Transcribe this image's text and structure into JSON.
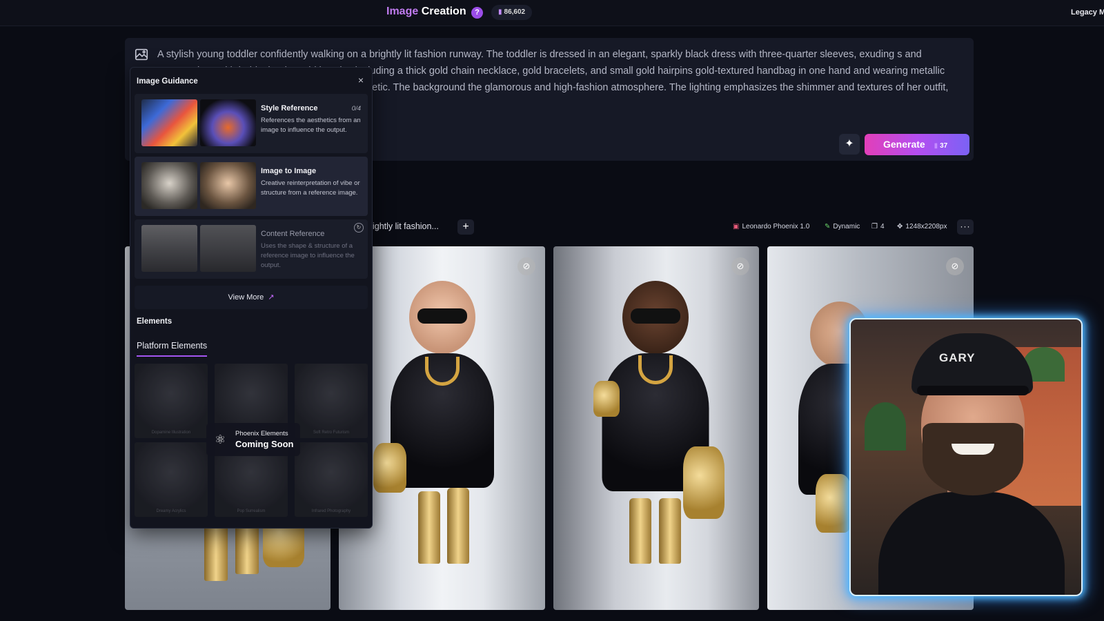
{
  "header": {
    "title_part1": "Image",
    "title_part2": "Creation",
    "help_glyph": "?",
    "tokens": "86,602",
    "legacy_label": "Legacy M"
  },
  "prompt": {
    "text": "A stylish young toddler confidently walking on a brightly lit fashion runway. The toddler is dressed in an elegant, sparkly black dress with three-quarter sleeves, exuding s and accessorizes with bold, chunky gold jewelry, including a thick gold chain necklace, gold bracelets, and small gold hairpins gold-textured handbag in one hand and wearing metallic gold boots that match the overall luxurious aesthetic. The background the glamorous and high-fashion atmosphere. The lighting emphasizes the shimmer and textures of her outfit, while her and charm.",
    "generate_label": "Generate",
    "generate_cost": "37"
  },
  "generation": {
    "title": "ightly lit fashion...",
    "add_glyph": "+",
    "model": "Leonardo Phoenix 1.0",
    "style": "Dynamic",
    "count": "4",
    "dimensions": "1248x2208px",
    "more_glyph": "···"
  },
  "guidance": {
    "title": "Image Guidance",
    "close_glyph": "×",
    "items": [
      {
        "name": "Style Reference",
        "count": "0/4",
        "desc": "References the aesthetics from an image to influence the output."
      },
      {
        "name": "Image to Image",
        "desc": "Creative reinterpretation of vibe or structure from a reference image."
      },
      {
        "name": "Content Reference",
        "desc": "Uses the shape & structure of a reference image to influence the output."
      }
    ],
    "view_more": "View More",
    "elements_title": "Elements",
    "elements_tab": "Platform Elements",
    "element_captions": [
      "Dopamine Illustration",
      "",
      "Soft Retro Futurism",
      "Dreamy Acrylics",
      "Pop Surrealism",
      "Infrared Photography"
    ],
    "coming_soon_line1": "Phoenix Elements",
    "coming_soon_line2": "Coming Soon"
  },
  "webcam": {
    "hat_text": "GARY"
  },
  "colors": {
    "accent_purple": "#a355f0",
    "generate_gradient_start": "#e23fb8",
    "generate_gradient_end": "#7b62f5",
    "webcam_glow": "#4fb8ff"
  }
}
